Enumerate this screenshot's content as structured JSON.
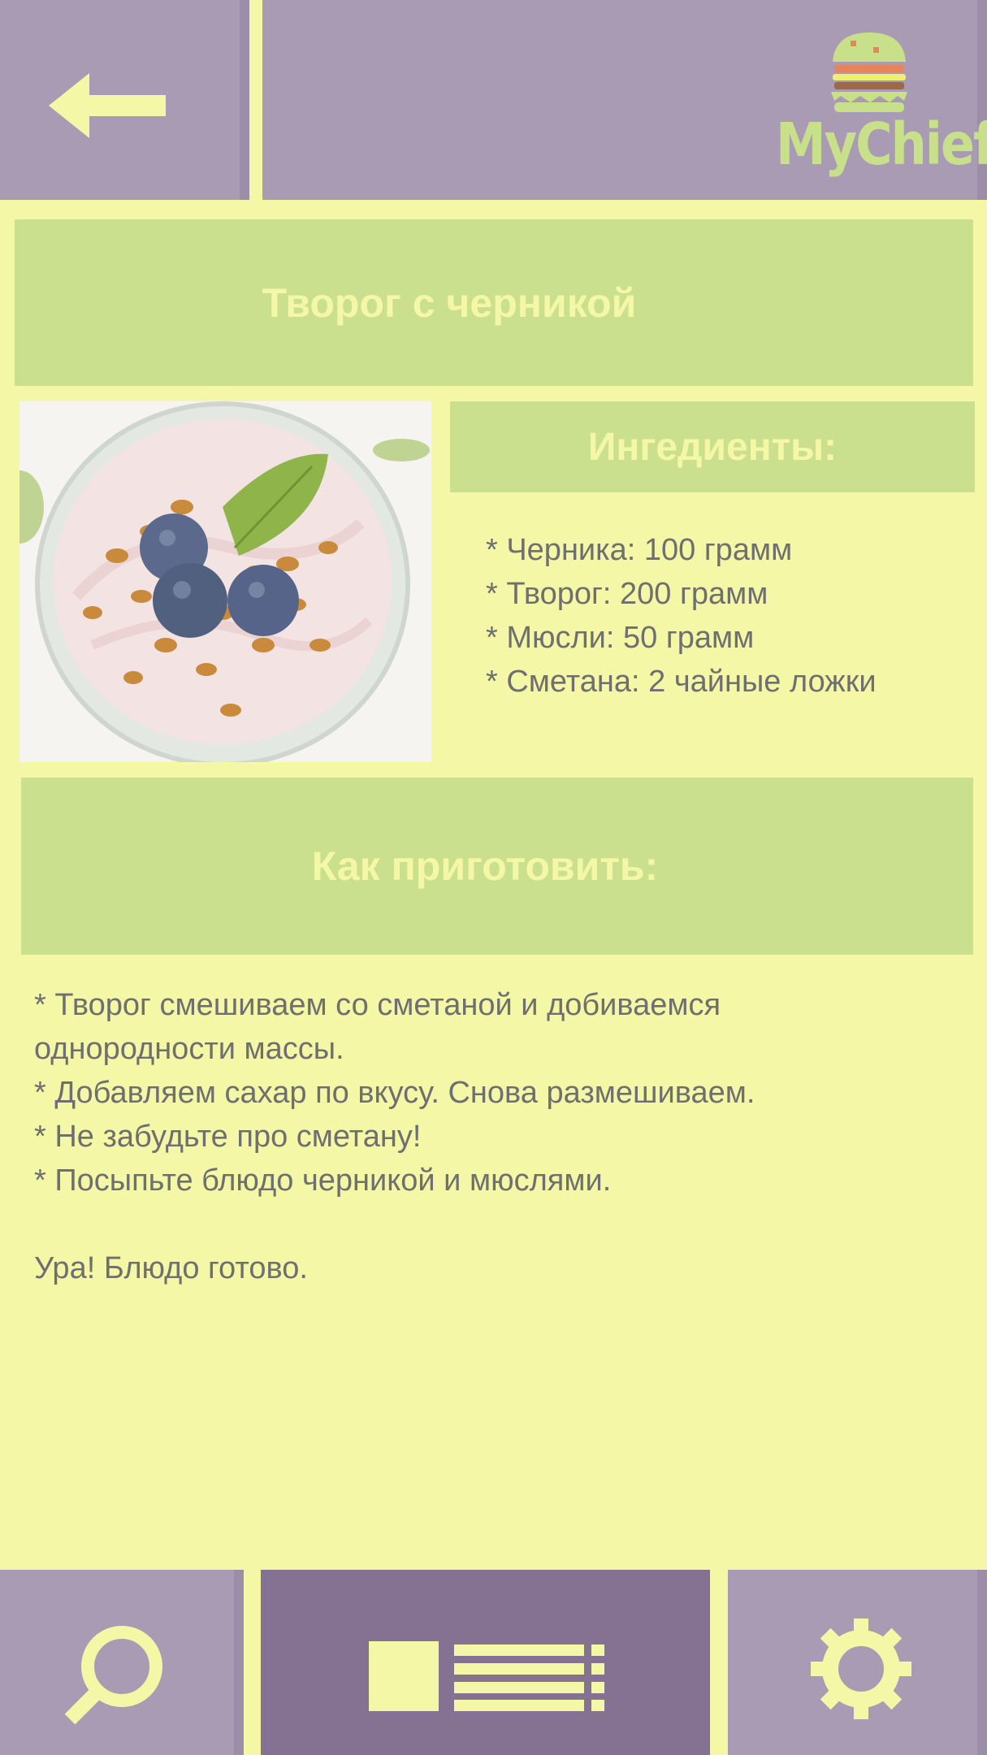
{
  "app": {
    "logo_text": "MyChief"
  },
  "header": {
    "back_icon": "arrow-left-icon",
    "logo_icon": "burger-icon"
  },
  "recipe": {
    "title": "Творог с черникой",
    "image_alt": "Творог с черникой и мюслями",
    "ingredients_heading": "Ингедиенты:",
    "ingredients": [
      "* Черника: 100 грамм",
      "* Творог: 200 грамм",
      "* Мюсли: 50 грамм",
      "* Сметана: 2 чайные ложки"
    ],
    "howto_heading": "Как приготовить:",
    "steps": [
      "* Творог смешиваем со сметаной и добиваемся",
      "однородности массы.",
      "* Добавляем сахар по вкусу. Снова размешиваем.",
      "* Не забудьте про сметану!",
      "* Посыпьте блюдо черникой и мюслями."
    ],
    "final_note": "Ура! Блюдо готово."
  },
  "nav": {
    "search_icon": "search-icon",
    "list_icon": "recipe-list-icon",
    "settings_icon": "gear-icon"
  },
  "colors": {
    "background": "#f4f8a6",
    "panel_green": "#cbe08f",
    "panel_purple": "#a89bb3",
    "active_purple": "#857192",
    "text_gray": "#6f6f6f"
  }
}
